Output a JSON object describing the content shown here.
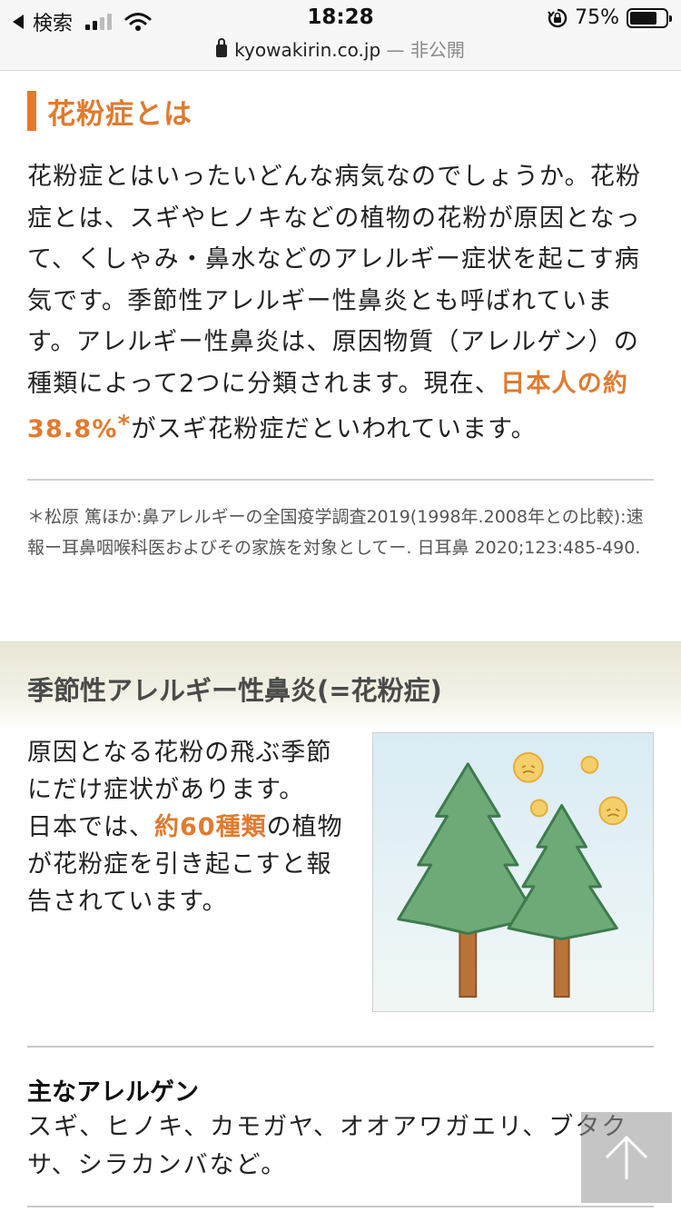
{
  "status_bar": {
    "back_label": "検索",
    "time": "18:28",
    "battery_percent": "75%",
    "battery_level": 0.75,
    "icons": [
      "back-arrow-icon",
      "cell-signal-icon",
      "wifi-icon",
      "rotation-lock-icon",
      "battery-icon"
    ]
  },
  "url_bar": {
    "domain": "kyowakirin.co.jp",
    "suffix": " — 非公開"
  },
  "section1": {
    "heading": "花粉症とは",
    "body_start": "花粉症とはいったいどんな病気なのでしょうか。花粉症とは、スギやヒノキなどの植物の花粉が原因となって、くしゃみ・鼻水などのアレルギー症状を起こす病気です。季節性アレルギー性鼻炎とも呼ばれています。アレルギー性鼻炎は、原因物質（アレルゲン）の種類によって2つに分類されます。現在、",
    "highlight": "日本人の約38.8%",
    "asterisk": "*",
    "body_end": "がスギ花粉症だといわれています。",
    "footnote": "＊松原 篤ほか:鼻アレルギーの全国疫学調査2019(1998年.2008年との比較):速報ー耳鼻咽喉科医およびその家族を対象としてー. 日耳鼻 2020;123:485-490."
  },
  "section2": {
    "heading": "季節性アレルギー性鼻炎(=花粉症)",
    "text_a": "原因となる花粉の飛ぶ季節にだけ症状があります。",
    "text_b": "日本では、",
    "highlight": "約60種類",
    "text_c": "の植物が花粉症を引き起こすと報告されています。",
    "illustration": "cedar-trees-pollen-illustration"
  },
  "allergens": {
    "title": "主なアレルゲン",
    "list": "スギ、ヒノキ、カモガヤ、オオアワガエリ、ブタクサ、シラカンバなど。"
  },
  "scroll_top_button": {
    "icon": "arrow-up-icon"
  },
  "colors": {
    "accent": "#e07b2f",
    "band": "#efece0",
    "text": "#222222"
  }
}
